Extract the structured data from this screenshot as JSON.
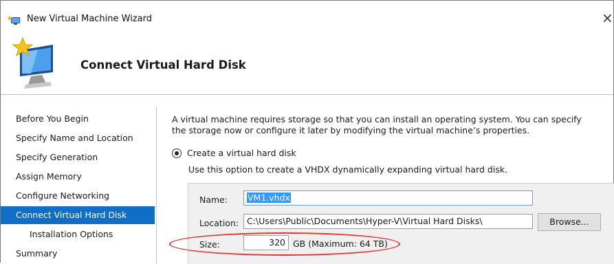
{
  "window": {
    "title": "New Virtual Machine Wizard",
    "close_glyph": "×"
  },
  "header": {
    "title": "Connect Virtual Hard Disk",
    "icon": "monitor-star-icon"
  },
  "sidebar": {
    "items": [
      {
        "label": "Before You Begin",
        "active": false
      },
      {
        "label": "Specify Name and Location",
        "active": false
      },
      {
        "label": "Specify Generation",
        "active": false
      },
      {
        "label": "Assign Memory",
        "active": false
      },
      {
        "label": "Configure Networking",
        "active": false
      },
      {
        "label": "Connect Virtual Hard Disk",
        "active": true
      },
      {
        "label": "Installation Options",
        "active": false,
        "sub": true
      },
      {
        "label": "Summary",
        "active": false
      }
    ]
  },
  "main": {
    "description": "A virtual machine requires storage so that you can install an operating system. You can specify the storage now or configure it later by modifying the virtual machine’s properties.",
    "option_create": {
      "label": "Create a virtual hard disk",
      "selected": true,
      "hint": "Use this option to create a VHDX dynamically expanding virtual hard disk."
    },
    "name_label": "Name:",
    "name_value": "VM1.vhdx",
    "location_label": "Location:",
    "location_value": "C:\\Users\\Public\\Documents\\Hyper-V\\Virtual Hard Disks\\",
    "browse_label": "Browse...",
    "size_label": "Size:",
    "size_value": "320",
    "size_note": "GB (Maximum: 64 TB)"
  },
  "colors": {
    "accent": "#0f6fc6",
    "annotation": "#e3342f"
  }
}
